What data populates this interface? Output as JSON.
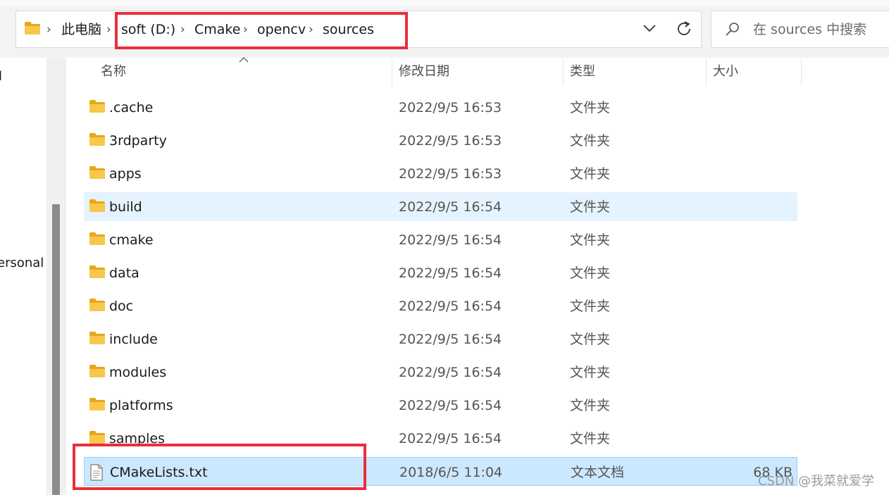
{
  "address": {
    "crumbs": [
      "此电脑",
      "soft (D:)",
      "Cmake",
      "opencv",
      "sources"
    ],
    "separator": "›"
  },
  "search": {
    "placeholder": "在 sources 中搜索"
  },
  "left_pane": {
    "items": [
      "l",
      "ersonal"
    ]
  },
  "columns": {
    "name": "名称",
    "date": "修改日期",
    "type": "类型",
    "size": "大小"
  },
  "files": [
    {
      "name": ".cache",
      "date": "2022/9/5 16:53",
      "type": "文件夹",
      "size": "",
      "kind": "folder"
    },
    {
      "name": "3rdparty",
      "date": "2022/9/5 16:53",
      "type": "文件夹",
      "size": "",
      "kind": "folder"
    },
    {
      "name": "apps",
      "date": "2022/9/5 16:53",
      "type": "文件夹",
      "size": "",
      "kind": "folder"
    },
    {
      "name": "build",
      "date": "2022/9/5 16:54",
      "type": "文件夹",
      "size": "",
      "kind": "folder"
    },
    {
      "name": "cmake",
      "date": "2022/9/5 16:54",
      "type": "文件夹",
      "size": "",
      "kind": "folder"
    },
    {
      "name": "data",
      "date": "2022/9/5 16:54",
      "type": "文件夹",
      "size": "",
      "kind": "folder"
    },
    {
      "name": "doc",
      "date": "2022/9/5 16:54",
      "type": "文件夹",
      "size": "",
      "kind": "folder"
    },
    {
      "name": "include",
      "date": "2022/9/5 16:54",
      "type": "文件夹",
      "size": "",
      "kind": "folder"
    },
    {
      "name": "modules",
      "date": "2022/9/5 16:54",
      "type": "文件夹",
      "size": "",
      "kind": "folder"
    },
    {
      "name": "platforms",
      "date": "2022/9/5 16:54",
      "type": "文件夹",
      "size": "",
      "kind": "folder"
    },
    {
      "name": "samples",
      "date": "2022/9/5 16:54",
      "type": "文件夹",
      "size": "",
      "kind": "folder"
    },
    {
      "name": "CMakeLists.txt",
      "date": "2018/6/5 11:04",
      "type": "文本文档",
      "size": "68 KB",
      "kind": "text-file"
    }
  ],
  "watermark": "CSDN @我菜就爱学",
  "colors": {
    "folder": "#f8c84a",
    "hover_row": "#e5f3ff",
    "selected_row": "#cce8ff",
    "annotation_red": "#e8303a"
  }
}
